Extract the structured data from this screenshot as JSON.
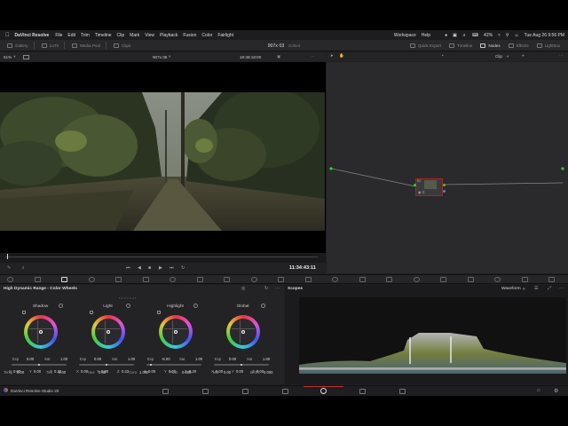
{
  "menubar": {
    "app_name": "DaVinci Resolve",
    "items": [
      "File",
      "Edit",
      "Trim",
      "Timeline",
      "Clip",
      "Mark",
      "View",
      "Playback",
      "Fusion",
      "Color",
      "Fairlight"
    ],
    "right_items": [
      "Workspace",
      "Help"
    ],
    "battery": "42%",
    "datetime": "Tue Aug 26  9:56 PM"
  },
  "toolbar": {
    "left": [
      "Gallery",
      "LUTs",
      "Media Pool",
      "Clips"
    ],
    "project_title": "907x 03",
    "edited": "Edited",
    "right": [
      "Quick Export",
      "Timeline",
      "Nodes",
      "Effects",
      "Lightbox"
    ]
  },
  "viewer": {
    "zoom": "51%",
    "clip_name": "907x 05",
    "timecode_top": "18:48:18:00",
    "timecode": "11:34:43:11"
  },
  "node_editor": {
    "mode": "Clip",
    "node_label": "01"
  },
  "color_panel": {
    "title": "High Dynamic Range - Color Wheels",
    "wheels": [
      {
        "name": "Shadow",
        "top_value": "+1.00",
        "exp": "0.00",
        "sat": "1.00",
        "x": "0.00",
        "y": "0.00",
        "z": "0.22"
      },
      {
        "name": "Light",
        "top_value": "-1.00",
        "exp": "0.00",
        "sat": "1.00",
        "x": "0.00",
        "y": "0.00",
        "z": "0.22"
      },
      {
        "name": "Highlight",
        "top_value": "+0.00",
        "exp": "-6.00",
        "sat": "1.00",
        "x": "0.00",
        "y": "0.00",
        "z": "0.20"
      },
      {
        "name": "Global",
        "top_value": "",
        "exp": "0.00",
        "sat": "1.00",
        "x": "0.00",
        "y": "0.00",
        "z": "0.00"
      }
    ],
    "bottom": [
      {
        "label": "Temp",
        "value": "0.00"
      },
      {
        "label": "Tint",
        "value": "0.00"
      },
      {
        "label": "Hue",
        "value": "0.00"
      },
      {
        "label": "Cont",
        "value": "1.000"
      },
      {
        "label": "Pivot",
        "value": "0.000"
      },
      {
        "label": "MD",
        "value": "0.00"
      },
      {
        "label": "B/Ofs",
        "value": "0.000"
      }
    ]
  },
  "scopes": {
    "title": "Scopes",
    "mode": "Waveform"
  },
  "status": {
    "product": "DaVinci Resolve Studio 20"
  }
}
